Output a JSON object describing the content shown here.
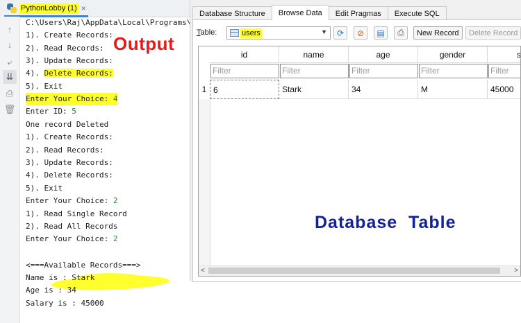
{
  "run_panel": {
    "tab_title": "PythonLobby (1)",
    "tab_close": "×",
    "gutter_icons": [
      "up-arrow-icon",
      "down-arrow-icon",
      "soft-wrap-icon",
      "scroll-to-end-icon",
      "print-icon",
      "trash-icon"
    ],
    "console_lines": [
      "C:\\Users\\Raj\\AppData\\Local\\Programs\\",
      "1). Create Records:",
      "2). Read Records:",
      "3). Update Records:",
      "4). Delete Records:",
      "5). Exit",
      "Enter Your Choice: 4",
      "Enter ID: 5",
      "One record Deleted",
      "1). Create Records:",
      "2). Read Records:",
      "3). Update Records:",
      "4). Delete Records:",
      "5). Exit",
      "Enter Your Choice: 2",
      "1). Read Single Record",
      "2). Read All Records",
      "Enter Your Choice: 2",
      "",
      "<===Available Records===>",
      "Name is : Stark",
      "Age is : 34",
      "Salary is : 45000"
    ],
    "annotation": "Output"
  },
  "db_browser": {
    "tabs": [
      "Database Structure",
      "Browse Data",
      "Edit Pragmas",
      "Execute SQL"
    ],
    "active_tab": "Browse Data",
    "table_label_prefix": "T",
    "table_label_rest": "able:",
    "selected_table": "users",
    "new_record": "New Record",
    "delete_record": "Delete Record",
    "columns": [
      "id",
      "name",
      "age",
      "gender",
      "sal"
    ],
    "filter_placeholder": "Filter",
    "rows": [
      {
        "rownum": "1",
        "cells": [
          "6",
          "Stark",
          "34",
          "M",
          "45000"
        ]
      }
    ],
    "annotation": "Database  Table",
    "scroll_left": "<",
    "scroll_right": ">"
  },
  "colors": {
    "highlight": "#ffff2e",
    "output_label": "#e21b1b",
    "db_label": "#12209a",
    "console_number": "#1b8a2a"
  }
}
